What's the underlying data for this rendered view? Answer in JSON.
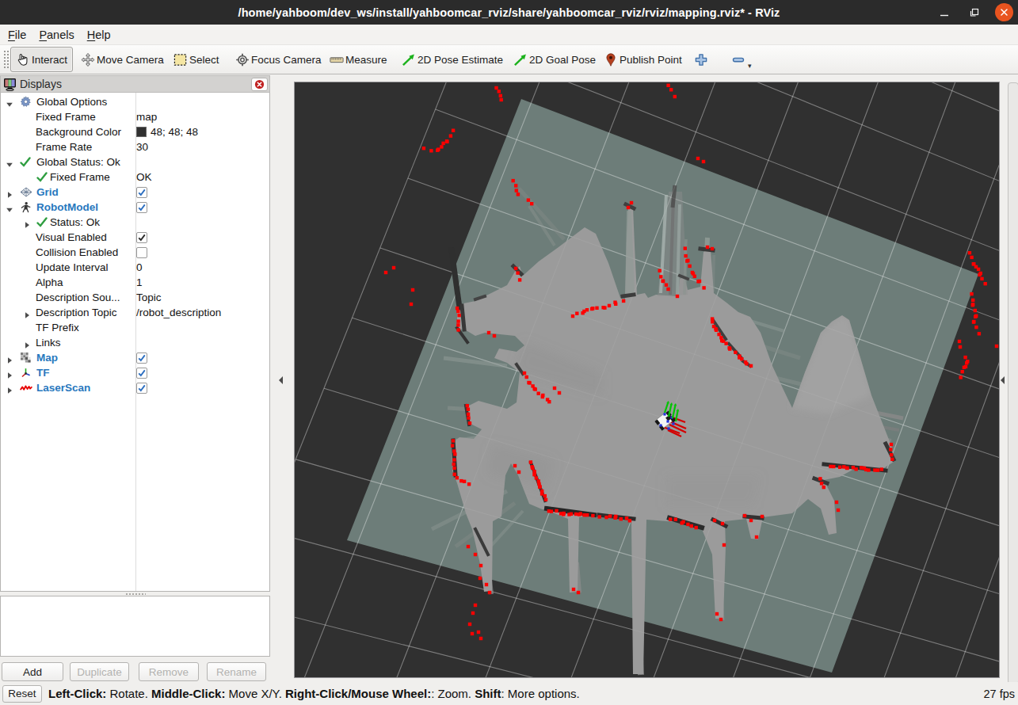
{
  "window": {
    "title": "/home/yahboom/dev_ws/install/yahboomcar_rviz/share/yahboomcar_rviz/rviz/mapping.rviz* - RViz",
    "controls": [
      "minimize",
      "maximize",
      "close"
    ]
  },
  "menu": {
    "items": [
      "File",
      "Panels",
      "Help"
    ]
  },
  "toolbar": {
    "buttons": [
      {
        "icon": "interact-icon",
        "label": "Interact",
        "selected": true
      },
      {
        "icon": "move-camera-icon",
        "label": "Move Camera",
        "selected": false
      },
      {
        "icon": "select-icon",
        "label": "Select",
        "selected": false
      },
      {
        "icon": "focus-camera-icon",
        "label": "Focus Camera",
        "selected": false
      },
      {
        "icon": "measure-icon",
        "label": "Measure",
        "selected": false
      },
      {
        "icon": "pose-estimate-icon",
        "label": "2D Pose Estimate",
        "selected": false
      },
      {
        "icon": "goal-pose-icon",
        "label": "2D Goal Pose",
        "selected": false
      },
      {
        "icon": "publish-point-icon",
        "label": "Publish Point",
        "selected": false
      },
      {
        "icon": "add-tool-icon",
        "label": "",
        "selected": false
      },
      {
        "icon": "remove-tool-icon",
        "label": "",
        "selected": false,
        "dropdown": true
      }
    ]
  },
  "displays_panel": {
    "title": "Displays",
    "rows": [
      {
        "indent": 6,
        "arrow": "down",
        "icon": "gear-icon",
        "label": "Global Options",
        "bold": false,
        "value": ""
      },
      {
        "indent": 44,
        "arrow": "none",
        "icon": null,
        "label": "Fixed Frame",
        "bold": false,
        "value": "map"
      },
      {
        "indent": 44,
        "arrow": "none",
        "icon": null,
        "label": "Background Color",
        "bold": false,
        "value": "48; 48; 48",
        "swatch": "#303030"
      },
      {
        "indent": 44,
        "arrow": "none",
        "icon": null,
        "label": "Frame Rate",
        "bold": false,
        "value": "30"
      },
      {
        "indent": 6,
        "arrow": "down",
        "icon": "check-icon",
        "label": "Global Status: Ok",
        "bold": false,
        "value": ""
      },
      {
        "indent": 45,
        "arrow": "none",
        "icon": "check-icon",
        "label": "Fixed Frame",
        "bold": false,
        "value": "OK",
        "icon_at": 45,
        "text_at": 62
      },
      {
        "indent": 6,
        "arrow": "right",
        "icon": "grid-icon",
        "label": "Grid",
        "bold": true,
        "checkbox": true,
        "checked": true,
        "check_color": "#2d6fc0"
      },
      {
        "indent": 6,
        "arrow": "down",
        "icon": "robot-icon",
        "label": "RobotModel",
        "bold": true,
        "checkbox": true,
        "checked": true,
        "check_color": "#2d6fc0"
      },
      {
        "indent": 28,
        "arrow": "right",
        "icon": "check-icon",
        "label": "Status: Ok",
        "bold": false,
        "value": "",
        "icon_at": 45,
        "text_at": 62
      },
      {
        "indent": 44,
        "arrow": "none",
        "icon": null,
        "label": "Visual Enabled",
        "bold": false,
        "checkbox": true,
        "checked": true,
        "check_color": "#2b2b2b"
      },
      {
        "indent": 44,
        "arrow": "none",
        "icon": null,
        "label": "Collision Enabled",
        "bold": false,
        "checkbox": true,
        "checked": false
      },
      {
        "indent": 44,
        "arrow": "none",
        "icon": null,
        "label": "Update Interval",
        "bold": false,
        "value": "0"
      },
      {
        "indent": 44,
        "arrow": "none",
        "icon": null,
        "label": "Alpha",
        "bold": false,
        "value": "1"
      },
      {
        "indent": 44,
        "arrow": "none",
        "icon": null,
        "label": "Description Sou...",
        "bold": false,
        "value": "Topic"
      },
      {
        "indent": 28,
        "arrow": "right",
        "icon": null,
        "label": "Description Topic",
        "bold": false,
        "value": "/robot_description",
        "text_at": 44
      },
      {
        "indent": 44,
        "arrow": "none",
        "icon": null,
        "label": "TF Prefix",
        "bold": false,
        "value": ""
      },
      {
        "indent": 28,
        "arrow": "right",
        "icon": null,
        "label": "Links",
        "bold": false,
        "value": "",
        "text_at": 44
      },
      {
        "indent": 6,
        "arrow": "right",
        "icon": "map-icon",
        "label": "Map",
        "bold": true,
        "checkbox": true,
        "checked": true,
        "check_color": "#2d6fc0"
      },
      {
        "indent": 6,
        "arrow": "right",
        "icon": "tf-icon",
        "label": "TF",
        "bold": true,
        "checkbox": true,
        "checked": true,
        "check_color": "#2d6fc0"
      },
      {
        "indent": 6,
        "arrow": "right",
        "icon": "laser-scan-icon",
        "label": "LaserScan",
        "bold": true,
        "checkbox": true,
        "checked": true,
        "check_color": "#2d6fc0"
      }
    ],
    "buttons": [
      {
        "label": "Add",
        "enabled": true
      },
      {
        "label": "Duplicate",
        "enabled": false
      },
      {
        "label": "Remove",
        "enabled": false
      },
      {
        "label": "Rename",
        "enabled": false
      }
    ]
  },
  "statusbar": {
    "reset_label": "Reset",
    "hints": [
      {
        "bold": "Left-Click:",
        "text": " Rotate. "
      },
      {
        "bold": "Middle-Click:",
        "text": " Move X/Y. "
      },
      {
        "bold": "Right-Click/Mouse Wheel:",
        "text": ": Zoom. "
      },
      {
        "bold": "Shift",
        "text": ": More options."
      }
    ],
    "fps": "27 fps"
  },
  "scene": {
    "background_color": "#303030",
    "map_unknown_color": "#6d7d79",
    "map_free_color": "#9b9b9b",
    "laser_color": "#fe0000",
    "grid_rotation_deg": 21,
    "laser_point_size": 4.4,
    "laser_points": [
      [
        252.3,
        4.8
      ],
      [
        255.6,
        9.2
      ],
      [
        257.6,
        14.7
      ],
      [
        258.5,
        19.8
      ],
      [
        469.4,
        1.6
      ],
      [
        473.0,
        7.1
      ],
      [
        477.6,
        15.8
      ],
      [
        160.7,
        81.0
      ],
      [
        170.2,
        84.1
      ],
      [
        178.0,
        83.5
      ],
      [
        179.2,
        82.4
      ],
      [
        183.2,
        79.2
      ],
      [
        185.4,
        74.7
      ],
      [
        190.2,
        72.7
      ],
      [
        189.8,
        72.0
      ],
      [
        194.7,
        65.4
      ],
      [
        197.9,
        58.5
      ],
      [
        273.5,
        121.9
      ],
      [
        277.0,
        128.2
      ],
      [
        277.6,
        134.4
      ],
      [
        279.7,
        139.2
      ],
      [
        292.7,
        146.4
      ],
      [
        297.0,
        151.0
      ],
      [
        112.8,
        237.8
      ],
      [
        122.8,
        231.8
      ],
      [
        146.8,
        259.8
      ],
      [
        144.8,
        277.8
      ],
      [
        202.9,
        282.9
      ],
      [
        204.1,
        286.8
      ],
      [
        205.4,
        291.9
      ],
      [
        204.4,
        299.4
      ],
      [
        204.2,
        304.2
      ],
      [
        204.4,
        310.3
      ],
      [
        215.6,
        406.0
      ],
      [
        216.7,
        410.5
      ],
      [
        216.9,
        416.6
      ],
      [
        217.3,
        421.4
      ],
      [
        218.8,
        428.1
      ],
      [
        197.7,
        450.3
      ],
      [
        196.9,
        456.4
      ],
      [
        199.1,
        463.3
      ],
      [
        200.1,
        467.2
      ],
      [
        199.2,
        474.3
      ],
      [
        198.5,
        479.7
      ],
      [
        199.4,
        484.7
      ],
      [
        199.5,
        492.6
      ],
      [
        202.7,
        497.0
      ],
      [
        208.1,
        500.9
      ],
      [
        211.9,
        501.6
      ],
      [
        217.9,
        505.0
      ],
      [
        348.8,
        292.9
      ],
      [
        354.1,
        289.5
      ],
      [
        361.4,
        289.0
      ],
      [
        363.2,
        286.8
      ],
      [
        366.8,
        285.0
      ],
      [
        373.0,
        283.8
      ],
      [
        374.1,
        283.1
      ],
      [
        379.3,
        282.6
      ],
      [
        387.4,
        282.0
      ],
      [
        389.2,
        282.4
      ],
      [
        394.8,
        279.7
      ],
      [
        402.3,
        275.5
      ],
      [
        403.0,
        277.6
      ],
      [
        412.9,
        273.7
      ],
      [
        418.8,
        155.8
      ],
      [
        422.8,
        149.8
      ],
      [
        458.5,
        235.5
      ],
      [
        460.1,
        243.2
      ],
      [
        462.5,
        248.5
      ],
      [
        462.9,
        248.8
      ],
      [
        466.8,
        253.5
      ],
      [
        469.3,
        258.8
      ],
      [
        480.8,
        267.8
      ],
      [
        490.6,
        207.4
      ],
      [
        491.4,
        216.9
      ],
      [
        494.1,
        222.7
      ],
      [
        493.1,
        223.3
      ],
      [
        496.4,
        229.7
      ],
      [
        500.8,
        239.3
      ],
      [
        499.7,
        237.8
      ],
      [
        502.6,
        242.6
      ],
      [
        507.3,
        249.1
      ],
      [
        508.8,
        248.8
      ],
      [
        514.4,
        257.2
      ],
      [
        518.8,
        205.8
      ],
      [
        524.8,
        207.8
      ],
      [
        276.9,
        232.7
      ],
      [
        279.4,
        238.4
      ],
      [
        281.9,
        247.2
      ],
      [
        524.9,
        296.4
      ],
      [
        525.1,
        300.1
      ],
      [
        526.8,
        305.9
      ],
      [
        529.9,
        310.6
      ],
      [
        529.3,
        309.0
      ],
      [
        533.4,
        315.9
      ],
      [
        536.2,
        320.1
      ],
      [
        538.8,
        324.5
      ],
      [
        537.0,
        323.9
      ],
      [
        542.4,
        327.4
      ],
      [
        546.4,
        333.1
      ],
      [
        547.1,
        334.4
      ],
      [
        554.2,
        338.6
      ],
      [
        559.1,
        345.3
      ],
      [
        559.2,
        343.4
      ],
      [
        562.0,
        347.0
      ],
      [
        566.9,
        350.9
      ],
      [
        568.2,
        353.0
      ],
      [
        573.8,
        355.7
      ],
      [
        674.3,
        482.7
      ],
      [
        678.1,
        482.8
      ],
      [
        686.0,
        483.6
      ],
      [
        691.1,
        483.2
      ],
      [
        694.8,
        484.7
      ],
      [
        695.3,
        484.7
      ],
      [
        702.7,
        484.0
      ],
      [
        706.5,
        486.1
      ],
      [
        713.0,
        484.3
      ],
      [
        716.7,
        484.8
      ],
      [
        719.0,
        486.7
      ],
      [
        722.2,
        487.3
      ],
      [
        730.2,
        487.3
      ],
      [
        733.9,
        487.4
      ],
      [
        738.7,
        486.3
      ],
      [
        661.2,
        498.2
      ],
      [
        662.9,
        504.1
      ],
      [
        665.6,
        508.9
      ],
      [
        681.8,
        527.8
      ],
      [
        683.8,
        537.8
      ],
      [
        750.8,
        454.9
      ],
      [
        750.1,
        461.2
      ],
      [
        751.0,
        468.1
      ],
      [
        752.1,
        473.6
      ],
      [
        849.7,
        213.0
      ],
      [
        852.4,
        218.7
      ],
      [
        855.1,
        227.0
      ],
      [
        854.6,
        227.1
      ],
      [
        857.8,
        230.6
      ],
      [
        860.9,
        233.7
      ],
      [
        863.6,
        238.8
      ],
      [
        862.3,
        240.7
      ],
      [
        865.3,
        245.7
      ],
      [
        869.5,
        252.0
      ],
      [
        852.3,
        264.9
      ],
      [
        854.0,
        272.7
      ],
      [
        853.6,
        279.0
      ],
      [
        854.0,
        278.1
      ],
      [
        856.6,
        285.8
      ],
      [
        857.0,
        293.6
      ],
      [
        858.0,
        292.6
      ],
      [
        855.1,
        299.8
      ],
      [
        854.8,
        300.4
      ],
      [
        858.2,
        306.9
      ],
      [
        861.7,
        315.1
      ],
      [
        836.8,
        324.8
      ],
      [
        837.8,
        331.8
      ],
      [
        883.8,
        330.8
      ],
      [
        844.4,
        344.9
      ],
      [
        847.1,
        350.1
      ],
      [
        846.0,
        352.1
      ],
      [
        844.8,
        356.7
      ],
      [
        842.7,
        357.6
      ],
      [
        840.5,
        363.0
      ],
      [
        838.5,
        370.3
      ],
      [
        506.8,
        93.8
      ],
      [
        513.8,
        97.8
      ],
      [
        318.7,
        539.0
      ],
      [
        321.8,
        539.4
      ],
      [
        328.3,
        538.7
      ],
      [
        333.9,
        542.2
      ],
      [
        337.0,
        543.2
      ],
      [
        337.5,
        541.8
      ],
      [
        344.3,
        543.3
      ],
      [
        346.8,
        542.6
      ],
      [
        352.8,
        542.8
      ],
      [
        356.9,
        543.3
      ],
      [
        358.5,
        542.4
      ],
      [
        363.3,
        544.0
      ],
      [
        367.0,
        544.0
      ],
      [
        374.2,
        544.8
      ],
      [
        382.5,
        546.3
      ],
      [
        391.3,
        546.9
      ],
      [
        395.9,
        545.4
      ],
      [
        402.4,
        547.6
      ],
      [
        403.1,
        545.7
      ],
      [
        409.6,
        549.0
      ],
      [
        416.8,
        548.1
      ],
      [
        420.7,
        551.1
      ],
      [
        472.0,
        549.4
      ],
      [
        478.6,
        549.5
      ],
      [
        488.4,
        552.6
      ],
      [
        486.5,
        554.1
      ],
      [
        494.2,
        555.7
      ],
      [
        498.6,
        557.9
      ],
      [
        504.5,
        559.9
      ],
      [
        527.8,
        550.8
      ],
      [
        537.8,
        554.8
      ],
      [
        539.8,
        581.8
      ],
      [
        565.8,
        544.8
      ],
      [
        573.8,
        550.8
      ],
      [
        580.8,
        571.8
      ],
      [
        587.8,
        545.8
      ],
      [
        295.7,
        477.3
      ],
      [
        297.5,
        483.1
      ],
      [
        298.1,
        484.7
      ],
      [
        300.4,
        489.0
      ],
      [
        300.6,
        492.8
      ],
      [
        300.5,
        492.9
      ],
      [
        302.7,
        497.2
      ],
      [
        305.6,
        501.2
      ],
      [
        306.3,
        504.8
      ],
      [
        307.3,
        508.4
      ],
      [
        307.1,
        508.3
      ],
      [
        310.0,
        513.7
      ],
      [
        309.9,
        517.2
      ],
      [
        313.6,
        519.9
      ],
      [
        314.8,
        524.6
      ],
      [
        280.8,
        489.8
      ],
      [
        275.8,
        481.8
      ],
      [
        216.8,
        583.8
      ],
      [
        225.8,
        593.8
      ],
      [
        232.8,
        607.8
      ],
      [
        231.8,
        623.8
      ],
      [
        239.8,
        631.8
      ],
      [
        243.8,
        641.8
      ],
      [
        225.8,
        657.8
      ],
      [
        222.8,
        667.8
      ],
      [
        218.8,
        681.8
      ],
      [
        229.8,
        691.8
      ],
      [
        232.8,
        699.8
      ],
      [
        221.8,
        693.8
      ],
      [
        349.8,
        637.8
      ],
      [
        355.8,
        641.8
      ],
      [
        530.8,
        668.8
      ],
      [
        535.8,
        675.8
      ],
      [
        287.8,
        364.8
      ],
      [
        290.5,
        369.8
      ],
      [
        294.4,
        377.2
      ],
      [
        293.3,
        376.8
      ],
      [
        298.4,
        381.2
      ],
      [
        301.5,
        385.3
      ],
      [
        300.5,
        384.7
      ],
      [
        305.5,
        390.5
      ],
      [
        311.1,
        392.8
      ],
      [
        310.6,
        394.8
      ],
      [
        316.9,
        398.3
      ],
      [
        319.1,
        401.0
      ],
      [
        325.8,
        383.8
      ],
      [
        331.8,
        389.8
      ],
      [
        242.8,
        313.8
      ],
      [
        249.8,
        317.8
      ]
    ]
  }
}
